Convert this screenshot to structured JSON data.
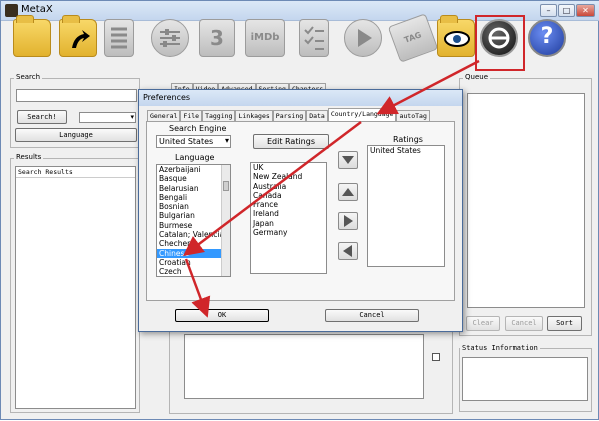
{
  "window": {
    "title": "MetaX",
    "minimize": "–",
    "maximize": "□",
    "close": "✕"
  },
  "toolbar": {
    "icons": [
      "folder-icon",
      "open-file-icon",
      "document-icon",
      "settings-sliders-icon",
      "season-3-icon",
      "imdb-icon",
      "checklist-icon",
      "play-icon",
      "tag-icon",
      "folder-eye-icon",
      "preferences-icon",
      "help-icon"
    ],
    "imdb": "iMDb",
    "tag": "TAG",
    "season": "3",
    "help": "?"
  },
  "left": {
    "search_label": "Search",
    "search_button": "Search!",
    "language_button": "Language",
    "results_label": "Results",
    "results_header": "Search Results"
  },
  "center": {
    "tabs": [
      "Info",
      "Video",
      "Advanced",
      "Sorting",
      "Chapters"
    ]
  },
  "right": {
    "queue_label": "Queue",
    "clear_button": "Clear",
    "cancel_button": "Cancel",
    "sort_button": "Sort",
    "status_label": "Status Information"
  },
  "dialog": {
    "title": "Preferences",
    "tabs": [
      "General",
      "File",
      "Tagging",
      "Linkages",
      "Parsing",
      "Data",
      "Country/Language",
      "autoTag"
    ],
    "search_engine_label": "Search Engine",
    "search_engine_value": "United States",
    "edit_ratings_button": "Edit Ratings",
    "language_label": "Language",
    "languages": [
      "Azerbaijani",
      "Basque",
      "Belarusian",
      "Bengali",
      "Bosnian",
      "Bulgarian",
      "Burmese",
      "Catalan; Valencian",
      "Chechen",
      "Chinese",
      "Croatian",
      "Czech"
    ],
    "selected_language": "Chinese",
    "countries": [
      "UK",
      "New Zealand",
      "Australia",
      "Canada",
      "France",
      "Ireland",
      "Japan",
      "Germany"
    ],
    "ratings_label": "Ratings",
    "ratings": [
      "United States"
    ],
    "ok_button": "OK",
    "cancel_button": "Cancel"
  },
  "colors": {
    "highlight": "#d0262a",
    "selection": "#3399ff"
  }
}
